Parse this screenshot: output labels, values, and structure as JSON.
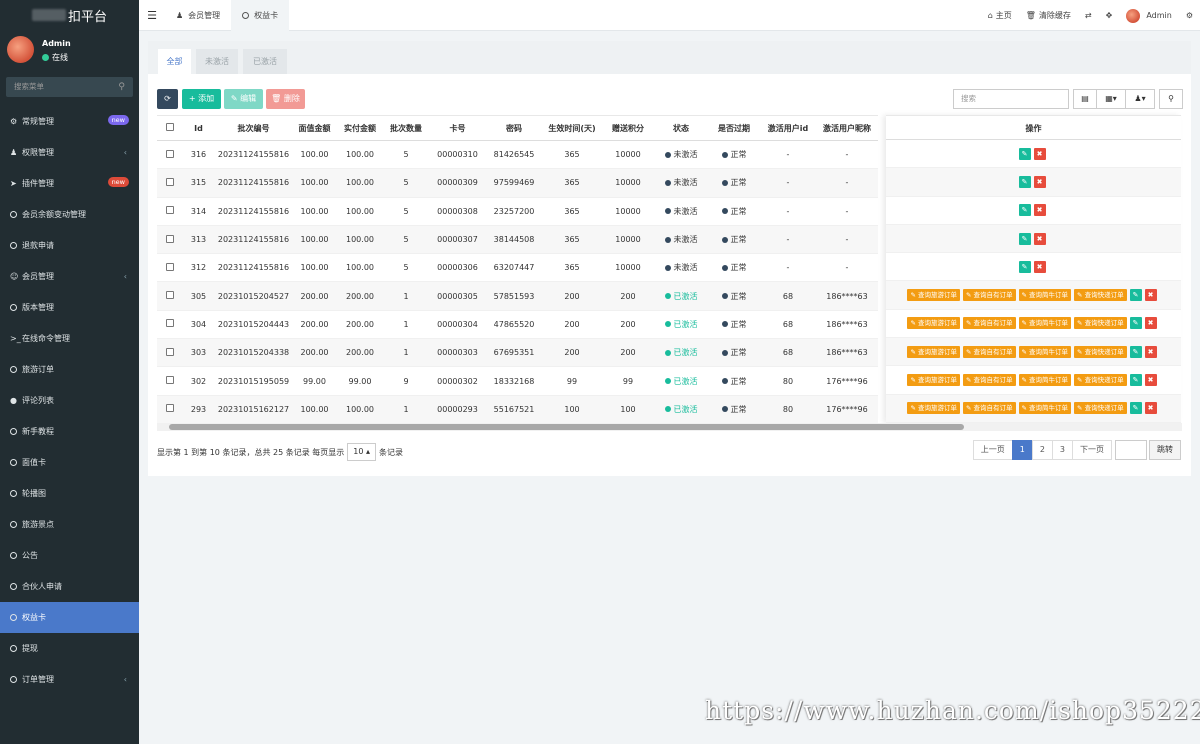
{
  "brand": {
    "title": "扣平台"
  },
  "user": {
    "name": "Admin",
    "status": "在线"
  },
  "sidebar": {
    "search_placeholder": "搜索菜单",
    "items": [
      {
        "label": "常规管理",
        "icon": "gears-icon",
        "badge": "new",
        "badge_color": "#7b68ee"
      },
      {
        "label": "权限管理",
        "icon": "group-icon",
        "chevron": true
      },
      {
        "label": "插件管理",
        "icon": "rocket-icon",
        "badge": "new",
        "badge_color": "#dd4b39"
      },
      {
        "label": "会员余额变动管理",
        "icon": "circle-icon"
      },
      {
        "label": "退款申请",
        "icon": "circle-icon"
      },
      {
        "label": "会员管理",
        "icon": "user-circle-icon",
        "chevron": true
      },
      {
        "label": "版本管理",
        "icon": "circle-icon"
      },
      {
        "label": "在线命令管理",
        "icon": "terminal-icon"
      },
      {
        "label": "旅游订单",
        "icon": "circle-icon"
      },
      {
        "label": "评论列表",
        "icon": "comment-icon"
      },
      {
        "label": "新手教程",
        "icon": "circle-icon"
      },
      {
        "label": "面值卡",
        "icon": "circle-icon"
      },
      {
        "label": "轮播图",
        "icon": "circle-icon"
      },
      {
        "label": "旅游景点",
        "icon": "circle-icon"
      },
      {
        "label": "公告",
        "icon": "circle-icon"
      },
      {
        "label": "合伙人申请",
        "icon": "circle-icon"
      },
      {
        "label": "权益卡",
        "icon": "circle-icon",
        "active": true
      },
      {
        "label": "提现",
        "icon": "circle-icon"
      },
      {
        "label": "订单管理",
        "icon": "circle-icon",
        "chevron": true
      }
    ]
  },
  "topbar": {
    "tabs": [
      {
        "label": "会员管理"
      },
      {
        "label": "权益卡"
      }
    ],
    "home": "主页",
    "clear_cache": "清除缓存",
    "admin": "Admin"
  },
  "panel": {
    "tabs": [
      "全部",
      "未激活",
      "已激活"
    ],
    "toolbar": {
      "add": "添加",
      "edit": "编辑",
      "delete": "删除",
      "search_placeholder": "搜索"
    },
    "columns": [
      "Id",
      "批次编号",
      "面值金额",
      "实付金额",
      "批次数量",
      "卡号",
      "密码",
      "生效时间(天)",
      "赠送积分",
      "状态",
      "是否过期",
      "激活用户id",
      "激活用户昵称"
    ],
    "ops_header": "操作",
    "op_buttons": [
      "查询旅游订单",
      "查询自有订单",
      "查询简牛订单",
      "查询快递订单"
    ],
    "rows": [
      {
        "id": "316",
        "batch": "20231124155816",
        "face": "100.00",
        "paid": "100.00",
        "qty": "5",
        "card": "00000310",
        "pwd": "81426545",
        "days": "365",
        "points": "10000",
        "status": "未激活",
        "expired": "正常",
        "uid": "-",
        "nick": "-",
        "activated": false
      },
      {
        "id": "315",
        "batch": "20231124155816",
        "face": "100.00",
        "paid": "100.00",
        "qty": "5",
        "card": "00000309",
        "pwd": "97599469",
        "days": "365",
        "points": "10000",
        "status": "未激活",
        "expired": "正常",
        "uid": "-",
        "nick": "-",
        "activated": false
      },
      {
        "id": "314",
        "batch": "20231124155816",
        "face": "100.00",
        "paid": "100.00",
        "qty": "5",
        "card": "00000308",
        "pwd": "23257200",
        "days": "365",
        "points": "10000",
        "status": "未激活",
        "expired": "正常",
        "uid": "-",
        "nick": "-",
        "activated": false
      },
      {
        "id": "313",
        "batch": "20231124155816",
        "face": "100.00",
        "paid": "100.00",
        "qty": "5",
        "card": "00000307",
        "pwd": "38144508",
        "days": "365",
        "points": "10000",
        "status": "未激活",
        "expired": "正常",
        "uid": "-",
        "nick": "-",
        "activated": false
      },
      {
        "id": "312",
        "batch": "20231124155816",
        "face": "100.00",
        "paid": "100.00",
        "qty": "5",
        "card": "00000306",
        "pwd": "63207447",
        "days": "365",
        "points": "10000",
        "status": "未激活",
        "expired": "正常",
        "uid": "-",
        "nick": "-",
        "activated": false
      },
      {
        "id": "305",
        "batch": "20231015204527",
        "face": "200.00",
        "paid": "200.00",
        "qty": "1",
        "card": "00000305",
        "pwd": "57851593",
        "days": "200",
        "points": "200",
        "status": "已激活",
        "expired": "正常",
        "uid": "68",
        "nick": "186****63",
        "activated": true
      },
      {
        "id": "304",
        "batch": "20231015204443",
        "face": "200.00",
        "paid": "200.00",
        "qty": "1",
        "card": "00000304",
        "pwd": "47865520",
        "days": "200",
        "points": "200",
        "status": "已激活",
        "expired": "正常",
        "uid": "68",
        "nick": "186****63",
        "activated": true
      },
      {
        "id": "303",
        "batch": "20231015204338",
        "face": "200.00",
        "paid": "200.00",
        "qty": "1",
        "card": "00000303",
        "pwd": "67695351",
        "days": "200",
        "points": "200",
        "status": "已激活",
        "expired": "正常",
        "uid": "68",
        "nick": "186****63",
        "activated": true
      },
      {
        "id": "302",
        "batch": "20231015195059",
        "face": "99.00",
        "paid": "99.00",
        "qty": "9",
        "card": "00000302",
        "pwd": "18332168",
        "days": "99",
        "points": "99",
        "status": "已激活",
        "expired": "正常",
        "uid": "80",
        "nick": "176****96",
        "activated": true
      },
      {
        "id": "293",
        "batch": "20231015162127",
        "face": "100.00",
        "paid": "100.00",
        "qty": "1",
        "card": "00000293",
        "pwd": "55167521",
        "days": "100",
        "points": "100",
        "status": "已激活",
        "expired": "正常",
        "uid": "80",
        "nick": "176****96",
        "activated": true
      }
    ],
    "pagination": {
      "info_prefix": "显示第 1 到第 10 条记录，总共 25 条记录 每页显示",
      "page_size": "10",
      "info_suffix": "条记录",
      "prev": "上一页",
      "pages": [
        "1",
        "2",
        "3"
      ],
      "current": "1",
      "next": "下一页",
      "go": "跳转"
    }
  },
  "colors": {
    "primary": "#4a79ca",
    "success": "#18bc9c",
    "warning": "#f39c12",
    "danger": "#e74c3c",
    "dark": "#34495e"
  },
  "watermark": "https://www.huzhan.com/ishop35222"
}
